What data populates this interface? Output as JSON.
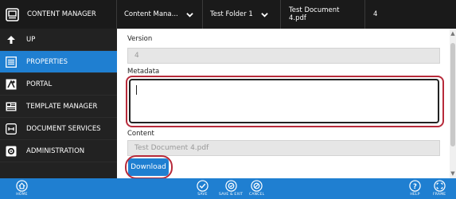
{
  "topbar": {
    "app_title": "CONTENT MANAGER",
    "breadcrumbs": [
      "Content Mana...",
      "Test Folder 1",
      "Test Document 4.pdf"
    ],
    "version_number": "4"
  },
  "sidebar": {
    "items": [
      {
        "label": "UP",
        "icon": "arrow-up-icon",
        "active": false
      },
      {
        "label": "PROPERTIES",
        "icon": "list-icon",
        "active": true
      },
      {
        "label": "PORTAL",
        "icon": "portal-icon",
        "active": false
      },
      {
        "label": "TEMPLATE MANAGER",
        "icon": "template-icon",
        "active": false
      },
      {
        "label": "DOCUMENT SERVICES",
        "icon": "services-icon",
        "active": false
      },
      {
        "label": "ADMINISTRATION",
        "icon": "gear-icon",
        "active": false
      }
    ]
  },
  "form": {
    "version_label": "Version",
    "version_value": "4",
    "metadata_label": "Metadata",
    "metadata_value": "",
    "content_label": "Content",
    "content_value": "Test Document 4.pdf",
    "download_label": "Download"
  },
  "bottombar": {
    "home_label": "HOME",
    "save_label": "SAVE",
    "save_exit_label": "SAVE & EXIT",
    "cancel_label": "CANCEL",
    "help_label": "HELP",
    "frame_label": "FRAME"
  },
  "colors": {
    "accent": "#1f7fd1",
    "dark": "#1a1a1a",
    "highlight": "#b72a3a"
  }
}
